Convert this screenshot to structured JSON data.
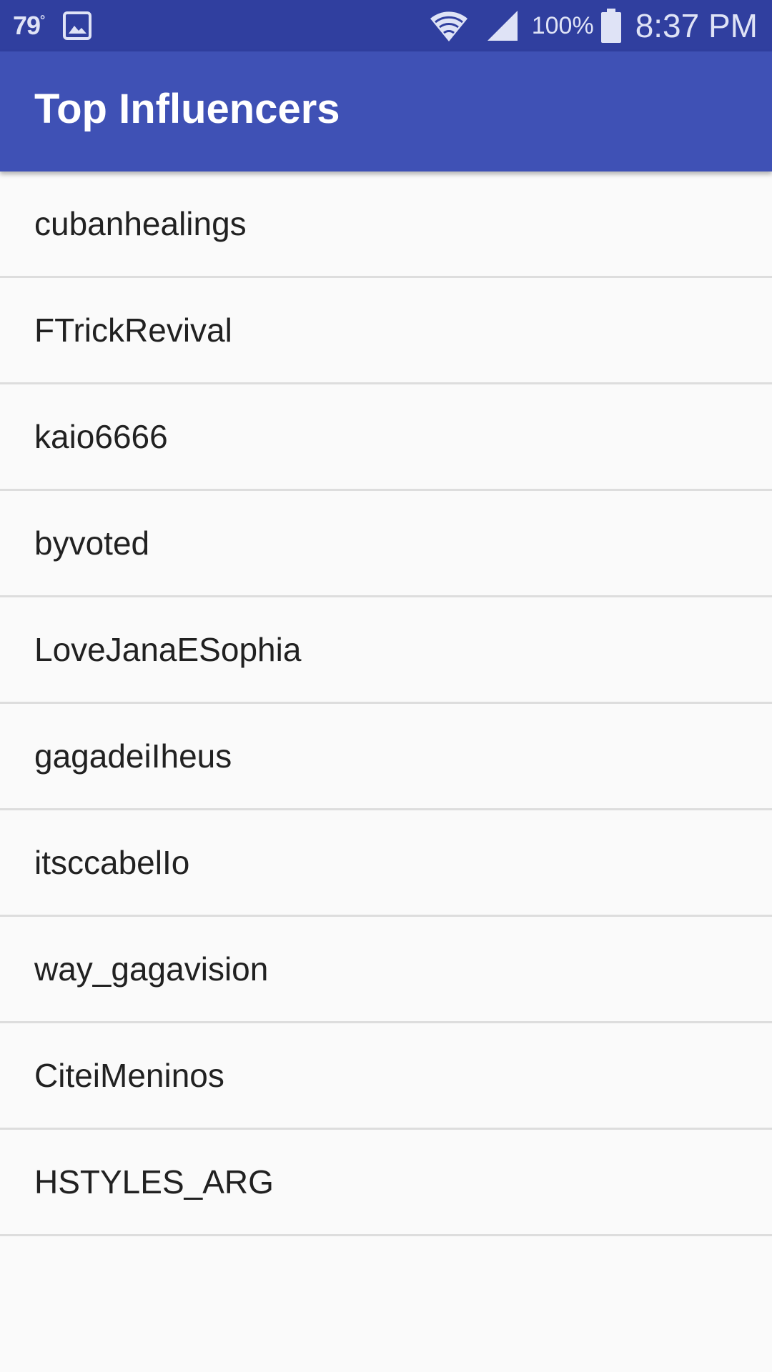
{
  "status_bar": {
    "temperature": "79",
    "degree": "°",
    "gallery_icon": "image-icon",
    "wifi_icon": "wifi-icon",
    "signal_icon": "cell-signal-icon",
    "battery_percent": "100%",
    "battery_icon": "battery-icon",
    "time": "8:37 PM"
  },
  "app_bar": {
    "title": "Top Influencers"
  },
  "influencers": [
    "cubanhealings",
    "FTrickRevival",
    "kaio6666",
    "byvoted",
    "LoveJanaESophia",
    "gagadeiIheus",
    "itsccabelIo",
    "way_gagavision",
    "CiteiMeninos",
    "HSTYLES_ARG"
  ],
  "colors": {
    "status_bar": "#303f9f",
    "app_bar": "#3f51b5",
    "background": "#fafafa",
    "divider": "#dddddd",
    "text": "#212121"
  }
}
